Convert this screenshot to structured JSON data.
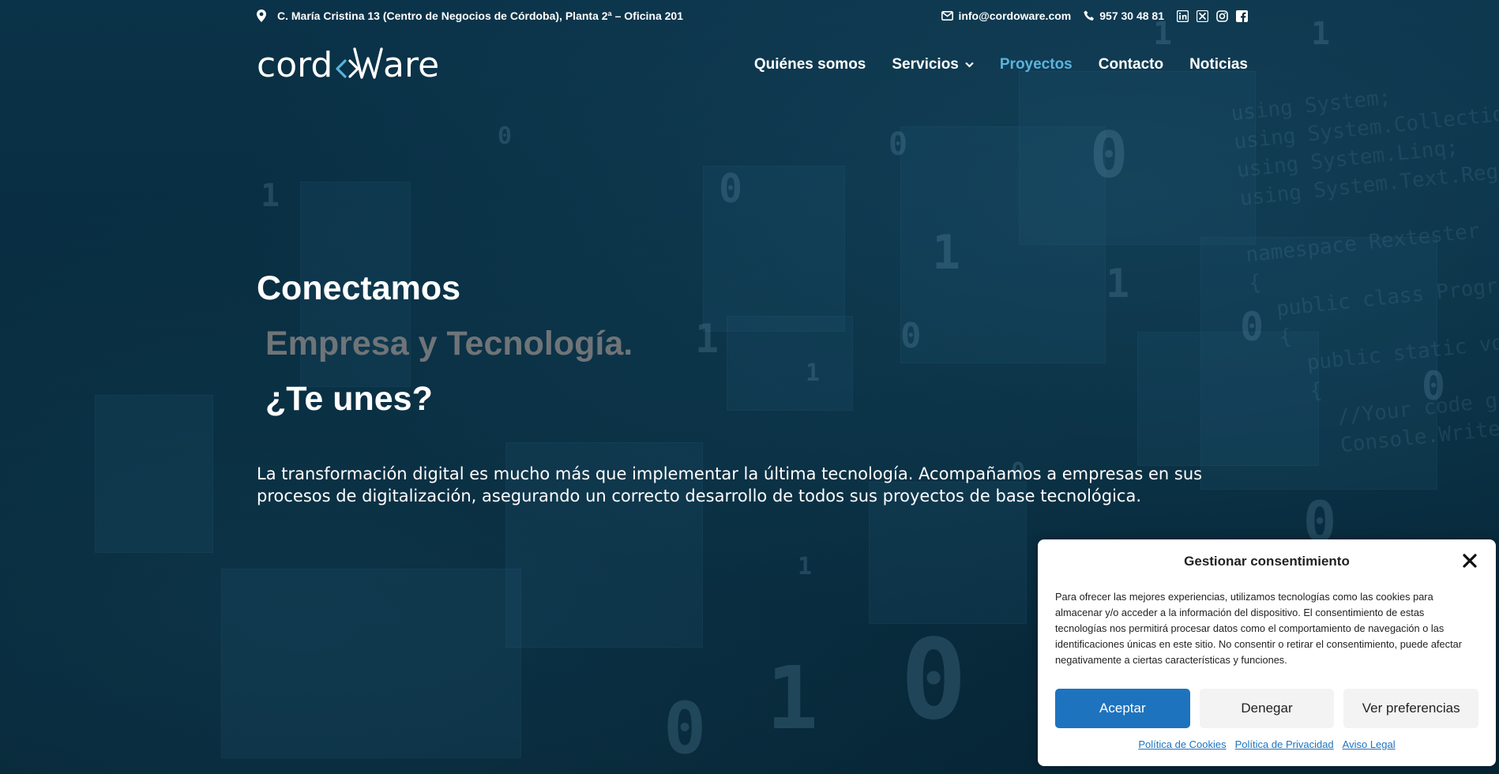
{
  "topbar": {
    "address": "C. María Cristina 13 (Centro de Negocios de Córdoba), Planta 2ª – Oficina 201",
    "email": "info@cordoware.com",
    "phone": "957 30 48 81",
    "icons": [
      "location-pin-icon",
      "envelope-icon",
      "phone-icon",
      "linkedin-icon",
      "x-twitter-icon",
      "instagram-icon",
      "facebook-icon"
    ]
  },
  "header": {
    "logo_text": "cordoware",
    "nav": [
      {
        "label": "Quiénes somos",
        "active": false
      },
      {
        "label": "Servicios",
        "active": false,
        "dropdown": true
      },
      {
        "label": "Proyectos",
        "active": true
      },
      {
        "label": "Contacto",
        "active": false
      },
      {
        "label": "Noticias",
        "active": false
      }
    ]
  },
  "hero": {
    "line1": "Conectamos",
    "line2": "Empresa y Tecnología.",
    "line3": "¿Te unes?",
    "paragraph": "La transformación digital es mucho más que implementar la última tecnología. Acompañamos a empresas en sus procesos de digitalización, asegurando un correcto desarrollo de todos sus proyectos de base tecnológica."
  },
  "consent": {
    "title": "Gestionar consentimiento",
    "text": "Para ofrecer las mejores experiencias, utilizamos tecnologías como las cookies para almacenar y/o acceder a la información del dispositivo. El consentimiento de estas tecnologías nos permitirá procesar datos como el comportamiento de navegación o las identificaciones únicas en este sitio. No consentir o retirar el consentimiento, puede afectar negativamente a ciertas características y funciones.",
    "accept_label": "Aceptar",
    "deny_label": "Denegar",
    "prefs_label": "Ver preferencias",
    "links": [
      "Política de Cookies",
      "Política de Privacidad",
      "Aviso Legal"
    ]
  },
  "colors": {
    "background": "#072b3e",
    "accent": "#5bb3dd",
    "primary_button": "#1e73be",
    "muted_heading": "#6f7478"
  }
}
